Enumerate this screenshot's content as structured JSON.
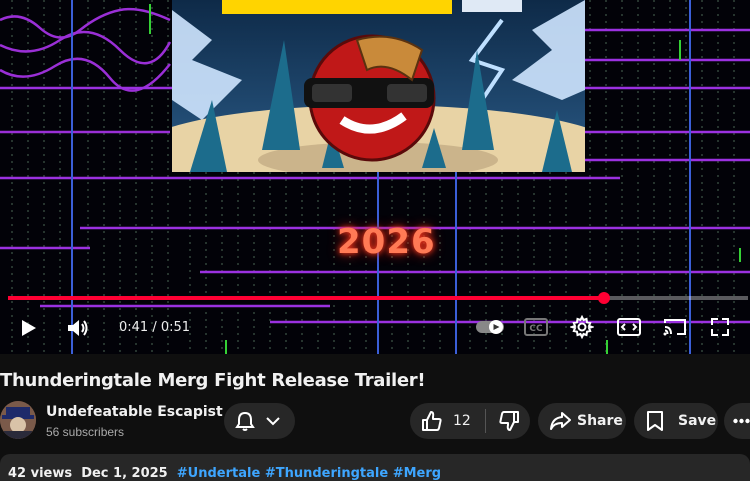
{
  "player": {
    "watermark_year": "2026",
    "progress_fraction": 0.805,
    "time_current": "0:41",
    "time_separator": " / ",
    "time_total": "0:51",
    "accent": "#ff0033"
  },
  "controls": {
    "play_icon": "play-icon",
    "volume_icon": "volume-icon",
    "autoplay_icon": "autoplay-toggle-icon",
    "cc_icon": "closed-captions-icon",
    "settings_icon": "gear-icon",
    "theater_icon": "theater-mode-icon",
    "cast_icon": "cast-icon",
    "fullscreen_icon": "fullscreen-icon"
  },
  "video": {
    "title": "Thunderingtale Merg Fight Release Trailer!"
  },
  "channel": {
    "name": "Undefeatable Escapist",
    "subscribers": "56 subscribers"
  },
  "actions": {
    "like_count": "12",
    "share_label": "Share",
    "save_label": "Save"
  },
  "description": {
    "views": "42 views",
    "date": "Dec 1, 2025",
    "hashtags": [
      "#Undertale",
      "#Thunderingtale",
      "#Merg"
    ]
  }
}
